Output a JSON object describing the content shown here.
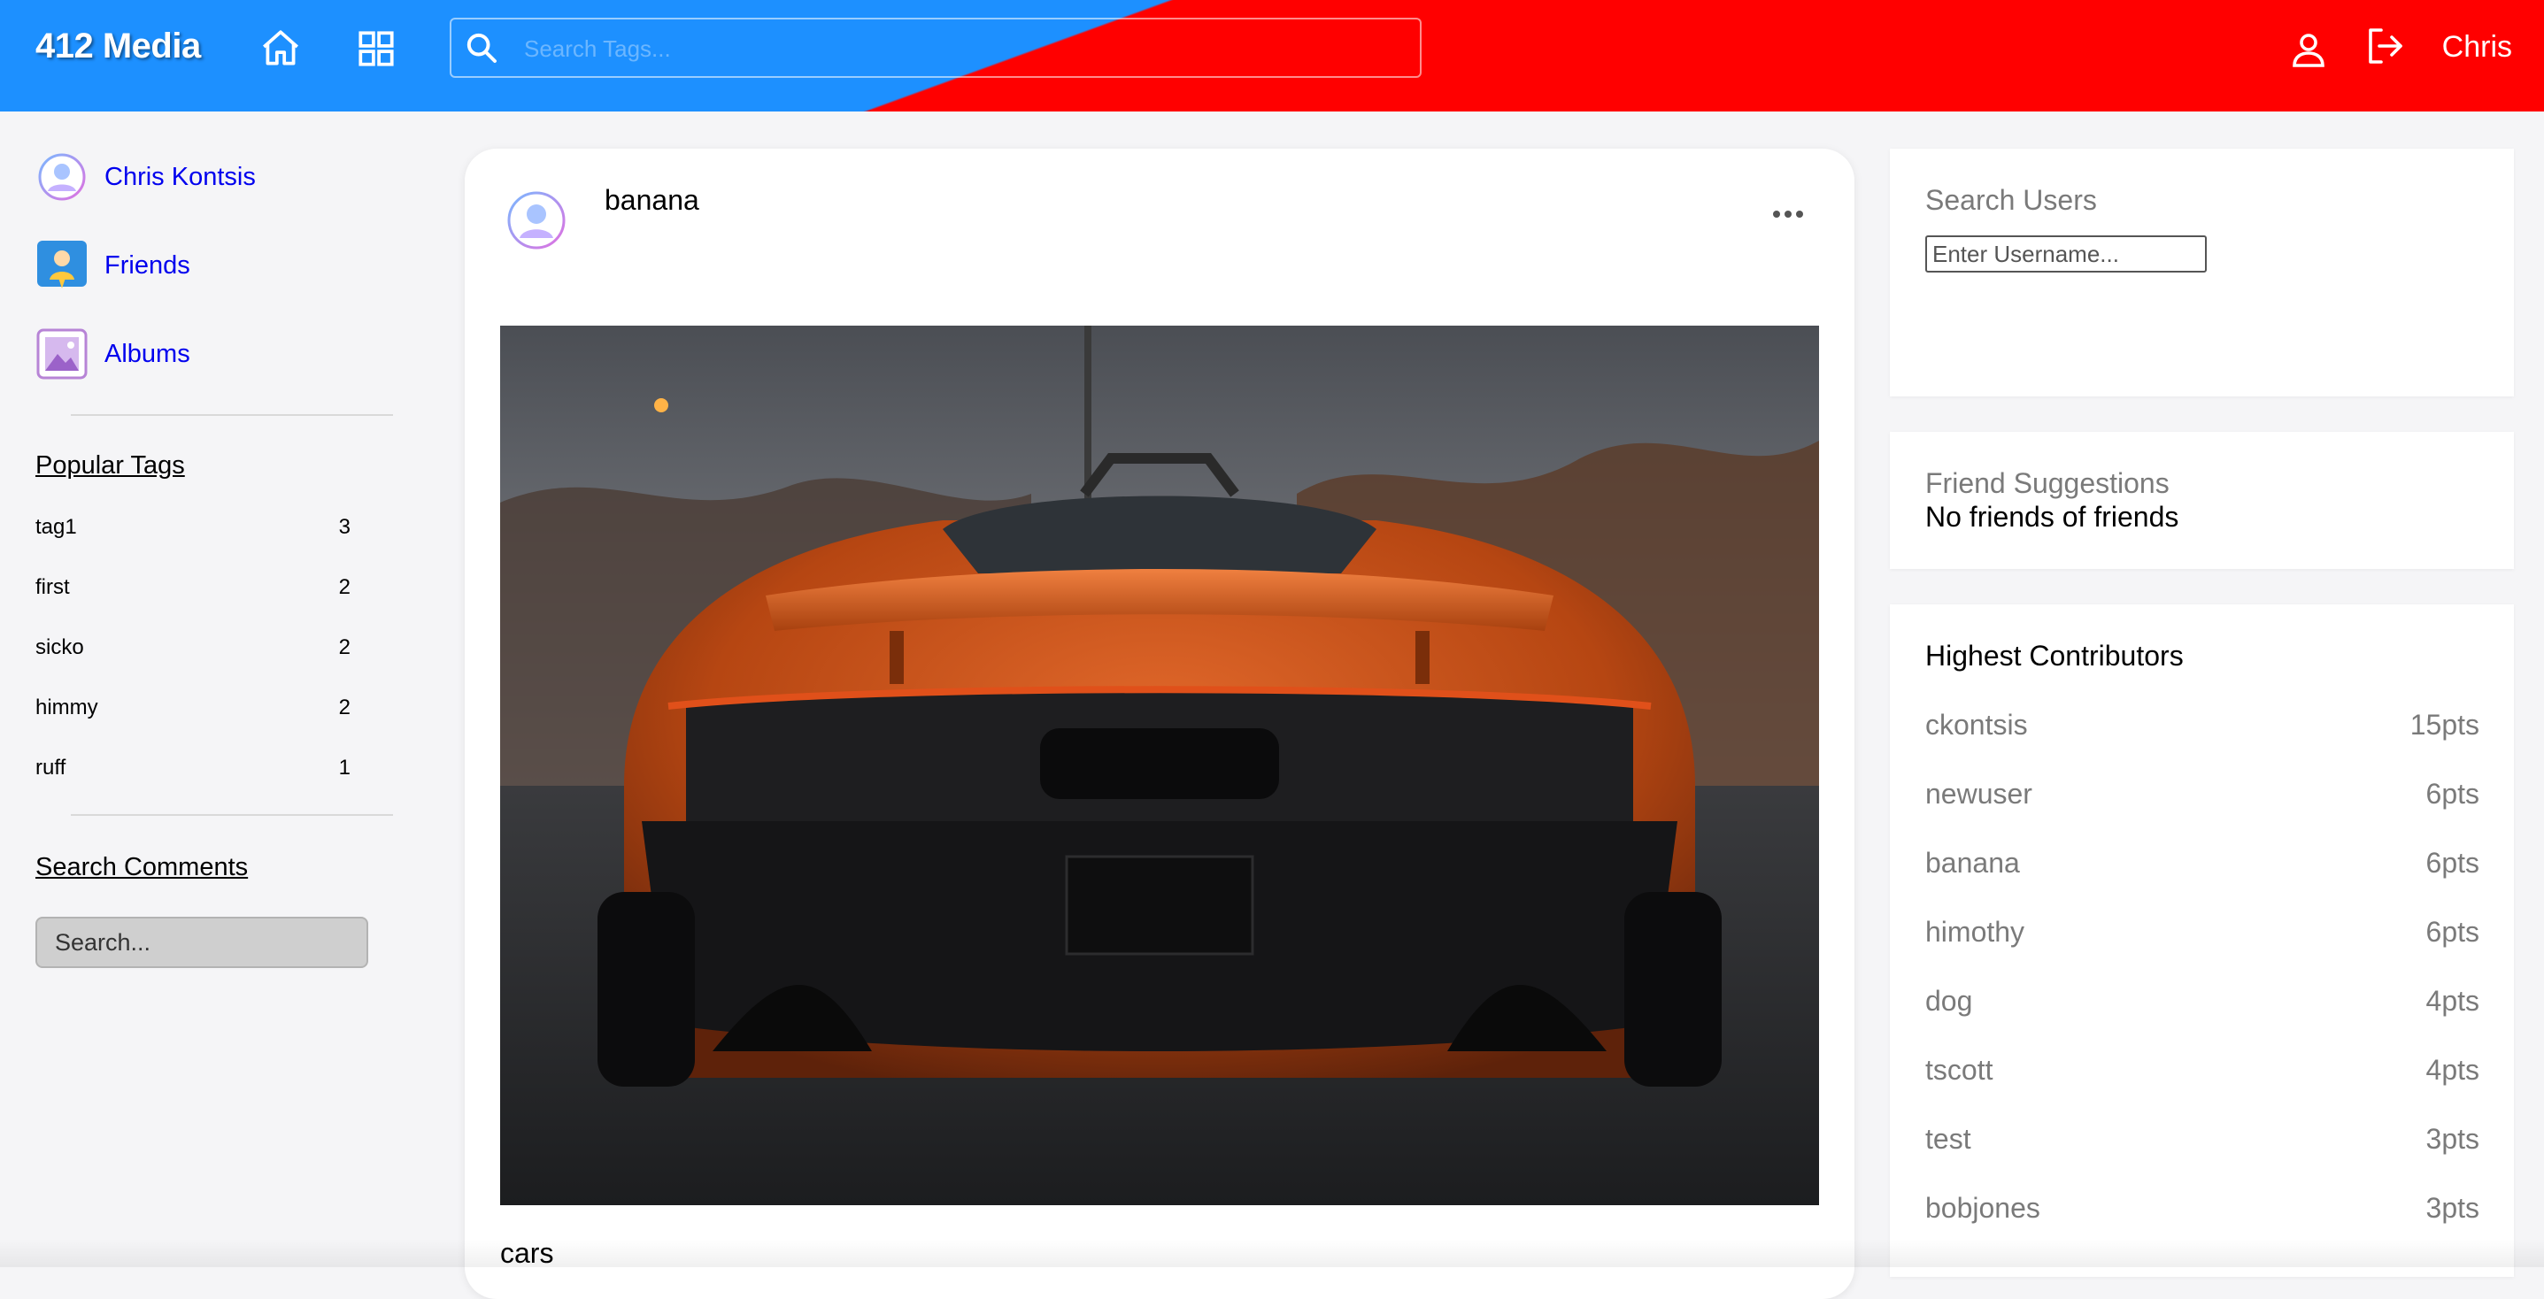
{
  "header": {
    "brand": "412 Media",
    "tag_search_placeholder": "Search Tags...",
    "user_name": "Chris",
    "colors": {
      "left": "#1d90ff",
      "right": "#ff0000"
    }
  },
  "sidebar": {
    "links": [
      {
        "label": "Chris Kontsis",
        "icon": "user-avatar-icon"
      },
      {
        "label": "Friends",
        "icon": "friends-icon"
      },
      {
        "label": "Albums",
        "icon": "albums-icon"
      }
    ],
    "popular_tags_title": "Popular Tags",
    "tags": [
      {
        "name": "tag1",
        "count": "3"
      },
      {
        "name": "first",
        "count": "2"
      },
      {
        "name": "sicko",
        "count": "2"
      },
      {
        "name": "himmy",
        "count": "2"
      },
      {
        "name": "ruff",
        "count": "1"
      }
    ],
    "search_comments_title": "Search Comments",
    "search_comments_placeholder": "Search..."
  },
  "post": {
    "author": "banana",
    "caption": "cars",
    "image": "orange-sports-car-rear-photo"
  },
  "right": {
    "search_users_title": "Search Users",
    "search_users_placeholder": "Enter Username...",
    "friend_suggestions_title": "Friend Suggestions",
    "friend_suggestions_empty": "No friends of friends",
    "contributors_title": "Highest Contributors",
    "contributors": [
      {
        "name": "ckontsis",
        "points": "15pts"
      },
      {
        "name": "newuser",
        "points": "6pts"
      },
      {
        "name": "banana",
        "points": "6pts"
      },
      {
        "name": "himothy",
        "points": "6pts"
      },
      {
        "name": "dog",
        "points": "4pts"
      },
      {
        "name": "tscott",
        "points": "4pts"
      },
      {
        "name": "test",
        "points": "3pts"
      },
      {
        "name": "bobjones",
        "points": "3pts"
      }
    ]
  }
}
